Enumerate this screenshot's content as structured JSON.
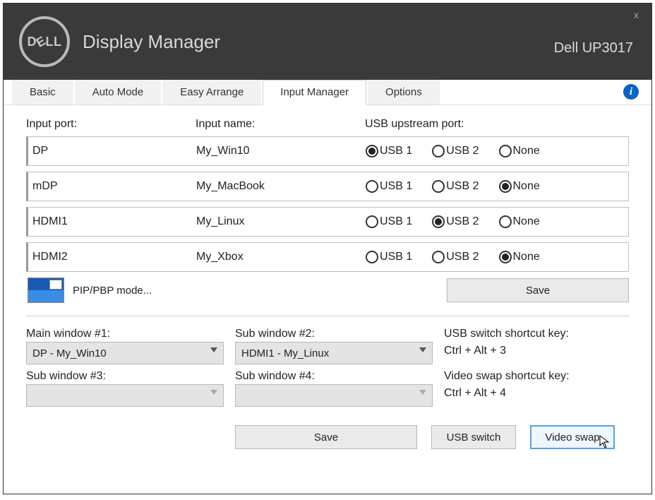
{
  "header": {
    "app_title": "Display Manager",
    "monitor": "Dell UP3017",
    "close": "x",
    "logo_text": "DELL"
  },
  "tabs": {
    "items": [
      {
        "label": "Basic",
        "active": false
      },
      {
        "label": "Auto Mode",
        "active": false
      },
      {
        "label": "Easy Arrange",
        "active": false
      },
      {
        "label": "Input Manager",
        "active": true
      },
      {
        "label": "Options",
        "active": false
      }
    ]
  },
  "columns": {
    "port": "Input port:",
    "name": "Input name:",
    "usb": "USB upstream port:"
  },
  "radio_labels": {
    "usb1": "USB 1",
    "usb2": "USB 2",
    "none": "None"
  },
  "inputs": [
    {
      "port": "DP",
      "name": "My_Win10",
      "usb": "usb1"
    },
    {
      "port": "mDP",
      "name": "My_MacBook",
      "usb": "none"
    },
    {
      "port": "HDMI1",
      "name": "My_Linux",
      "usb": "usb2"
    },
    {
      "port": "HDMI2",
      "name": "My_Xbox",
      "usb": "none"
    }
  ],
  "pip_label": "PIP/PBP mode...",
  "save_label": "Save",
  "windows": {
    "main_label": "Main window #1:",
    "sub2_label": "Sub window #2:",
    "sub3_label": "Sub window #3:",
    "sub4_label": "Sub window #4:",
    "main_value": "DP - My_Win10",
    "sub2_value": "HDMI1 - My_Linux",
    "sub3_value": "",
    "sub4_value": ""
  },
  "shortcuts": {
    "usb_label": "USB switch shortcut key:",
    "usb_value": "Ctrl + Alt + 3",
    "video_label": "Video swap shortcut key:",
    "video_value": "Ctrl + Alt + 4"
  },
  "buttons": {
    "save": "Save",
    "usb_switch": "USB switch",
    "video_swap": "Video swap"
  }
}
